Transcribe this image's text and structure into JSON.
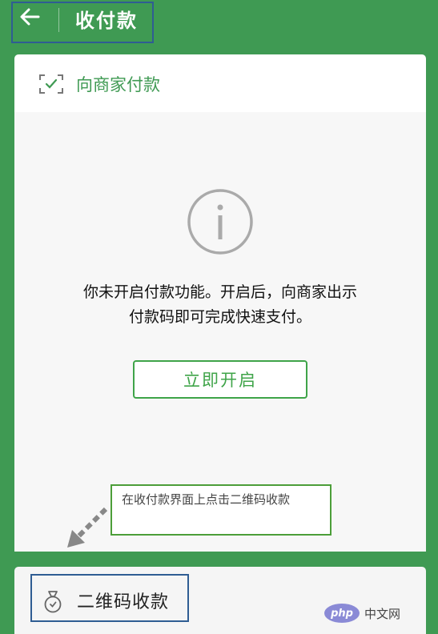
{
  "header": {
    "title": "收付款",
    "back_icon": "arrow-left-icon"
  },
  "payment_card": {
    "header_label": "向商家付款",
    "header_icon": "scan-check-icon",
    "info_icon": "info-circle-icon",
    "message_line1": "你未开启付款功能。开启后，向商家出示",
    "message_line2": "付款码即可完成快速支付。",
    "enable_button": "立即开启"
  },
  "annotation": {
    "text": "在收付款界面上点击二维码收款"
  },
  "qr_receive": {
    "label": "二维码收款",
    "icon": "money-bag-icon"
  },
  "watermark": {
    "logo": "php",
    "text": "中文网"
  },
  "colors": {
    "brand_green": "#3f9a53",
    "button_green": "#3fa449",
    "highlight_blue": "#2f5d93",
    "callout_border": "#4c9e39"
  }
}
